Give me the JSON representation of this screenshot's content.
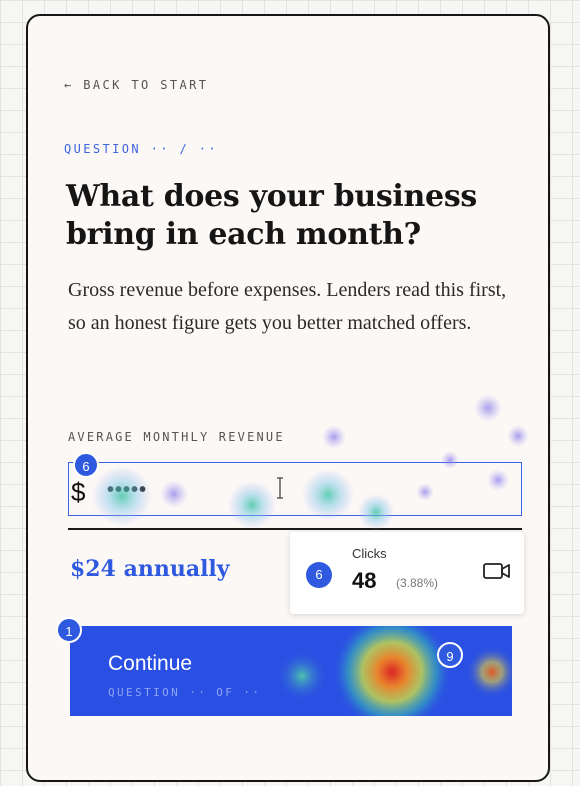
{
  "nav": {
    "back_label": "← BACK TO START"
  },
  "question": {
    "counter": "QUESTION ·· / ··"
  },
  "title": "What does your business bring in each month?",
  "subtitle": "Gross revenue before expenses. Lenders read this first, so an honest figure gets you better matched offers.",
  "revenue_field": {
    "label": "AVERAGE MONTHLY REVENUE",
    "currency_symbol": "$",
    "masked_value": "•••••",
    "marker_count": "6"
  },
  "annual_summary": "$24 annually",
  "continue_button": {
    "label": "Continue",
    "sublabel": "QUESTION ·· OF ··",
    "marker_count": "1"
  },
  "click_tooltip": {
    "badge": "6",
    "label": "Clicks",
    "count": "48",
    "percent": "(3.88%)",
    "icon": "video-camera-icon"
  },
  "heatmap_marker": {
    "count": "9"
  },
  "colors": {
    "accent": "#2f5ae0",
    "button_bg": "#2a4fe3",
    "card_bg": "#fbf8f6",
    "text_dark": "#151515"
  }
}
